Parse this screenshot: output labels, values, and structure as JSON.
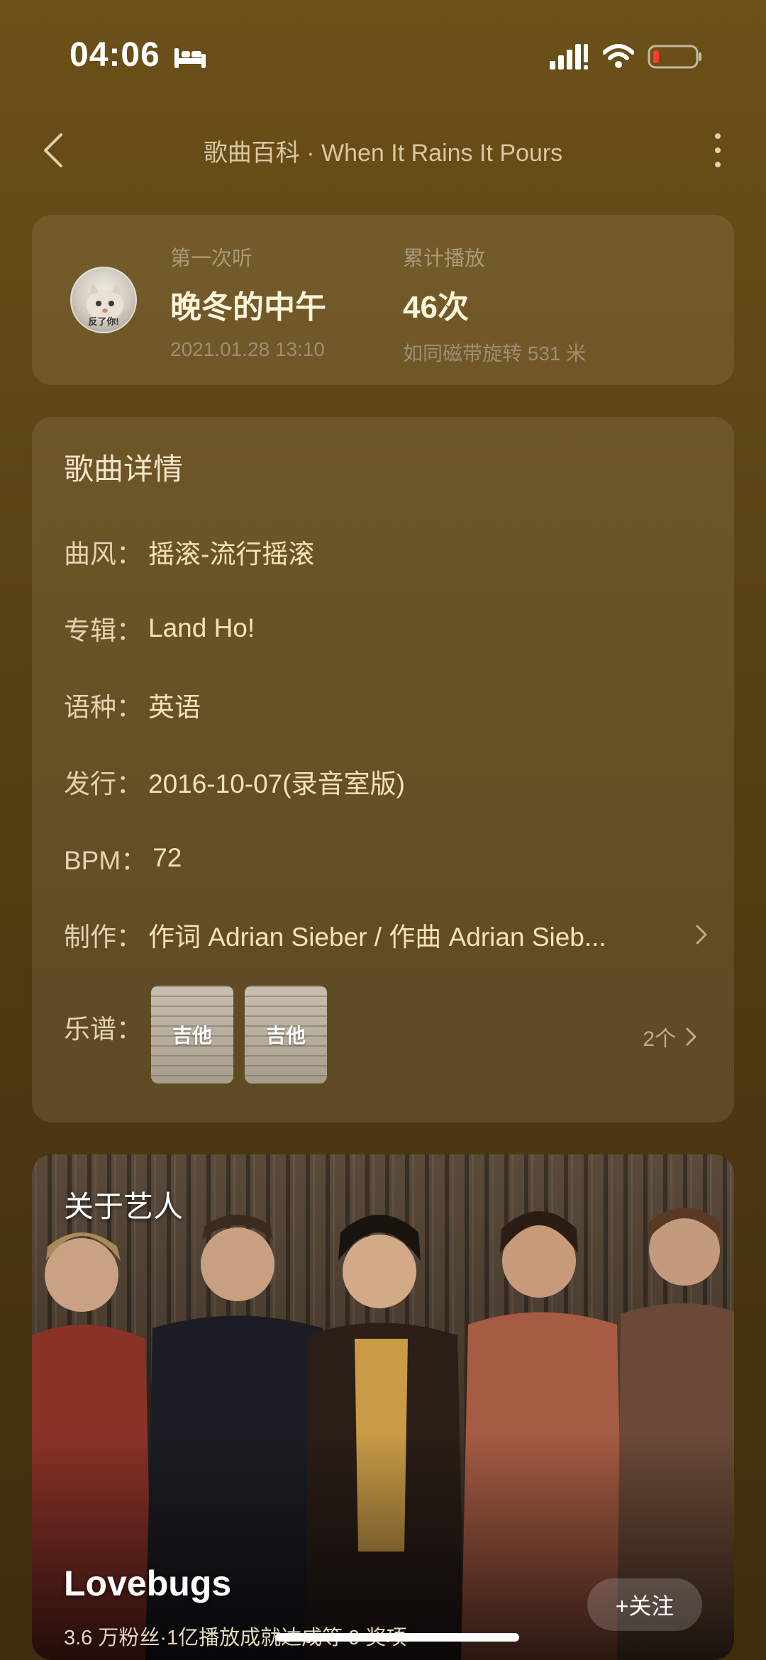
{
  "status": {
    "time": "04:06"
  },
  "header": {
    "title": "歌曲百科 · When It Rains It Pours"
  },
  "stats": {
    "first_listen_label": "第一次听",
    "first_listen_value": "晚冬的中午",
    "first_listen_date": "2021.01.28 13:10",
    "play_count_label": "累计播放",
    "play_count_value": "46次",
    "play_count_sub": "如同磁带旋转 531 米",
    "avatar_text": "反了你!"
  },
  "details": {
    "title": "歌曲详情",
    "rows": [
      {
        "label": "曲风：",
        "value": "摇滚-流行摇滚"
      },
      {
        "label": "专辑：",
        "value": "Land Ho!"
      },
      {
        "label": "语种：",
        "value": "英语"
      },
      {
        "label": "发行：",
        "value": "2016-10-07(录音室版)"
      },
      {
        "label": "BPM：",
        "value": "72"
      },
      {
        "label": "制作：",
        "value": "作词 Adrian Sieber / 作曲 Adrian Sieb..."
      }
    ],
    "sheets_label": "乐谱：",
    "sheets": [
      {
        "label": "吉他"
      },
      {
        "label": "吉他"
      }
    ],
    "sheets_count": "2个"
  },
  "artist": {
    "heading": "关于艺人",
    "name": "Lovebugs",
    "stats": "3.6 万粉丝·1亿播放成就达成等 9 奖项",
    "follow_label": "+关注"
  }
}
